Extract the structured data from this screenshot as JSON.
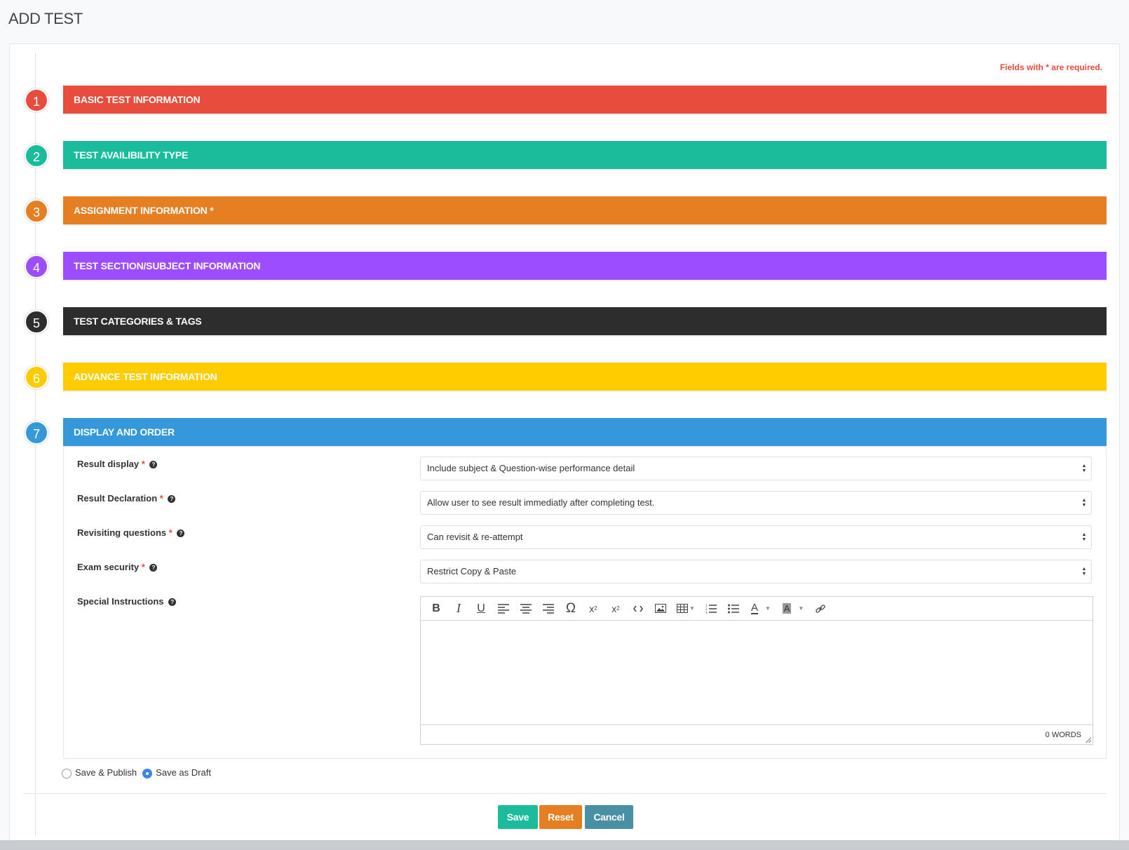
{
  "page": {
    "title": "ADD TEST",
    "required_note": "Fields with * are required."
  },
  "steps": [
    {
      "number": "1",
      "label": "BASIC TEST INFORMATION",
      "color": "#e74c3c"
    },
    {
      "number": "2",
      "label": "TEST AVAILIBILITY TYPE",
      "color": "#1abc9c"
    },
    {
      "number": "3",
      "label": "ASSIGNMENT INFORMATION *",
      "color": "#e67e22"
    },
    {
      "number": "4",
      "label": "TEST SECTION/SUBJECT INFORMATION",
      "color": "#9b4dff"
    },
    {
      "number": "5",
      "label": "TEST CATEGORIES & TAGS",
      "color": "#2d2d2d"
    },
    {
      "number": "6",
      "label": "ADVANCE TEST INFORMATION",
      "color": "#ffcc00"
    },
    {
      "number": "7",
      "label": "DISPLAY AND ORDER",
      "color": "#3498db"
    }
  ],
  "display_order": {
    "fields": [
      {
        "label": "Result display",
        "required": "*",
        "value": "Include subject & Question-wise performance detail"
      },
      {
        "label": "Result Declaration",
        "required": "*",
        "value": "Allow user to see result immediatly after completing test."
      },
      {
        "label": "Revisiting questions",
        "required": "*",
        "value": "Can revisit & re-attempt"
      },
      {
        "label": "Exam security",
        "required": "*",
        "value": "Restrict Copy & Paste"
      }
    ],
    "special_instructions": {
      "label": "Special Instructions",
      "word_count": "0 WORDS"
    }
  },
  "publish_options": [
    {
      "label": "Save & Publish",
      "checked": false
    },
    {
      "label": "Save as Draft",
      "checked": true
    }
  ],
  "actions": {
    "save": "Save",
    "reset": "Reset",
    "cancel": "Cancel"
  },
  "icons": {
    "toolbar": [
      "bold-icon",
      "italic-icon",
      "underline-icon",
      "align-left-icon",
      "align-center-icon",
      "align-right-icon",
      "omega-icon",
      "subscript-icon",
      "superscript-icon",
      "code-icon",
      "image-icon",
      "table-icon",
      "ordered-list-icon",
      "unordered-list-icon",
      "font-color-icon",
      "background-color-icon",
      "link-icon"
    ],
    "help": "question-circle-icon"
  },
  "colors": {
    "save": "#1abc9c",
    "reset": "#e67e22",
    "cancel": "#4a90a4",
    "required": "#e74c3c"
  }
}
